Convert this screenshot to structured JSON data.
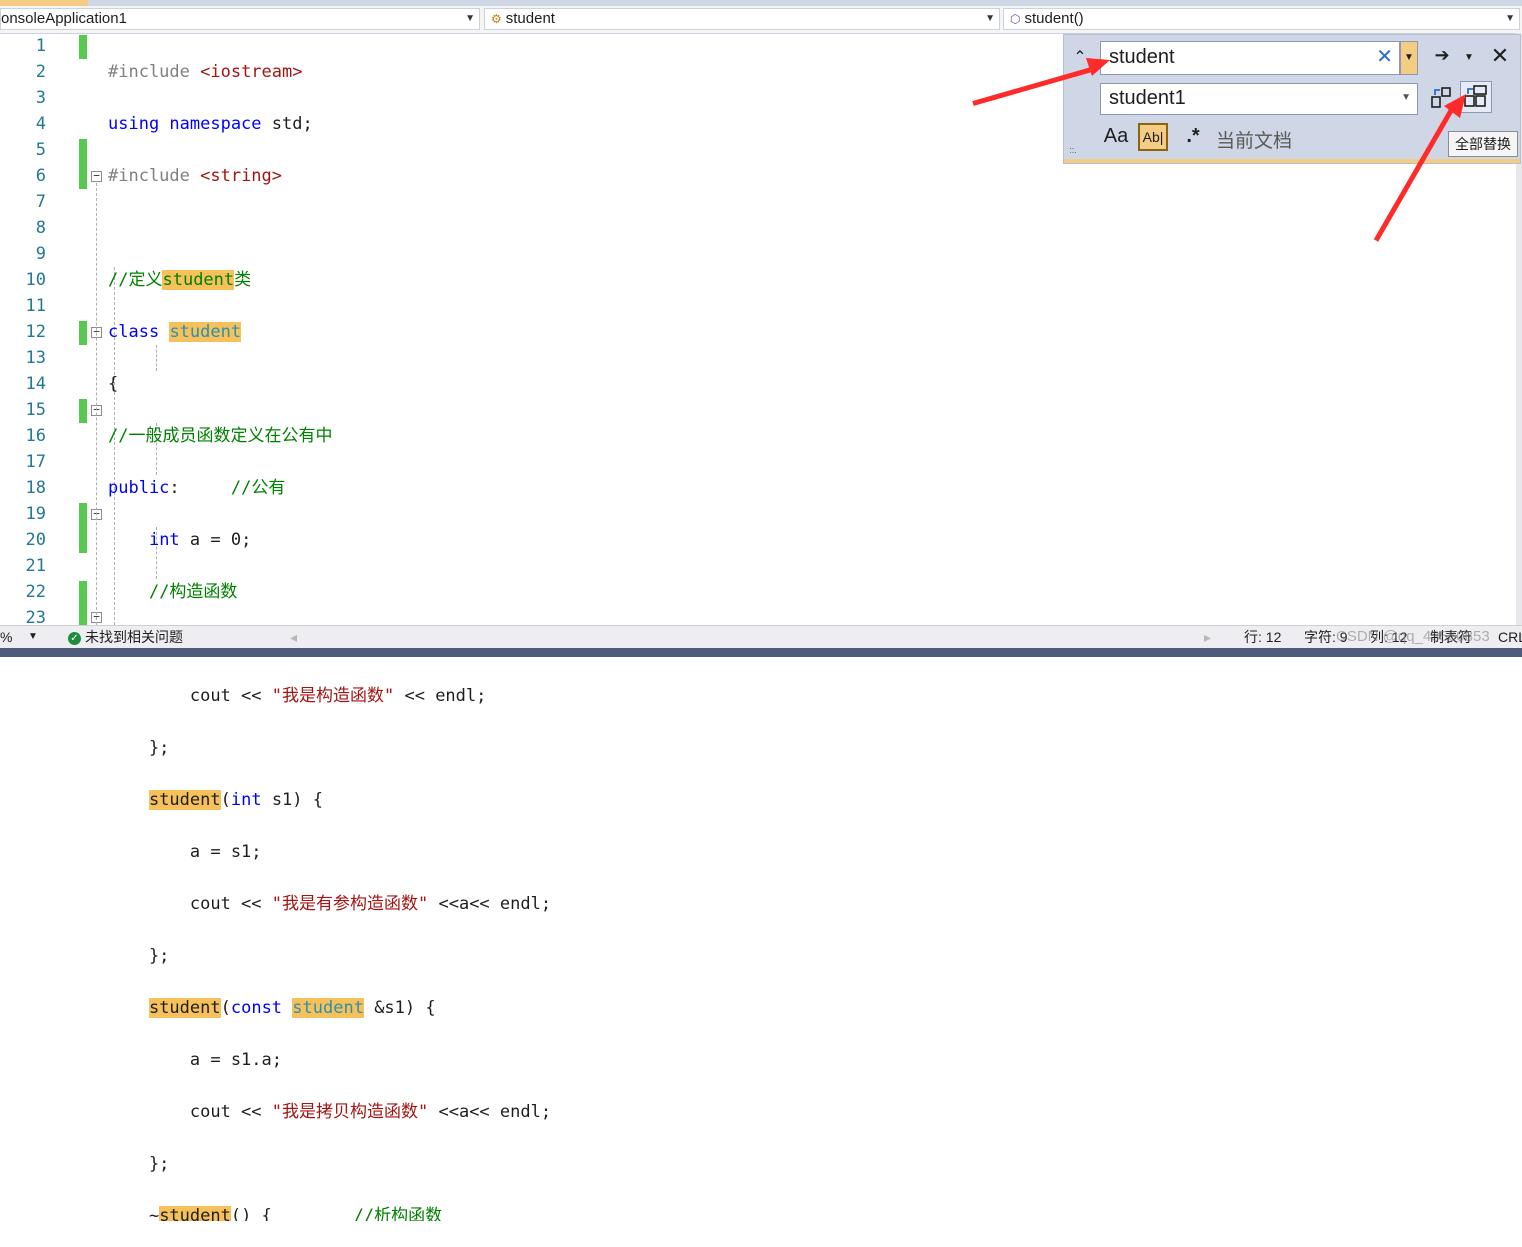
{
  "navbar": {
    "project": "onsoleApplication1",
    "class_scope": "student",
    "member_scope": "student()"
  },
  "find_panel": {
    "find_text": "student",
    "replace_text": "student1",
    "scope": "当前文档",
    "match_case_label": "Aa",
    "whole_word_label": "Ab|",
    "regex_label": ".*",
    "tooltip": "全部替换",
    "grip": "::."
  },
  "editor": {
    "line_numbers": [
      "1",
      "2",
      "3",
      "4",
      "5",
      "6",
      "7",
      "8",
      "9",
      "10",
      "11",
      "12",
      "13",
      "14",
      "15",
      "16",
      "17",
      "18",
      "19",
      "20",
      "21",
      "22",
      "23"
    ]
  },
  "statusbar": {
    "zoom": "%",
    "issues": "未找到相关问题",
    "line": "行: 12",
    "char": "字符: 9",
    "col": "列: 12",
    "tab": "制表符",
    "eol": "CRL",
    "watermark": "CSDN @qq_43560853"
  },
  "colors": {
    "keyword": "#0000ff",
    "comment": "#008000",
    "string": "#a31515",
    "highlight": "#f6c05a",
    "change_bar": "#57c94f",
    "annotation_arrow": "#ff2b2b"
  }
}
